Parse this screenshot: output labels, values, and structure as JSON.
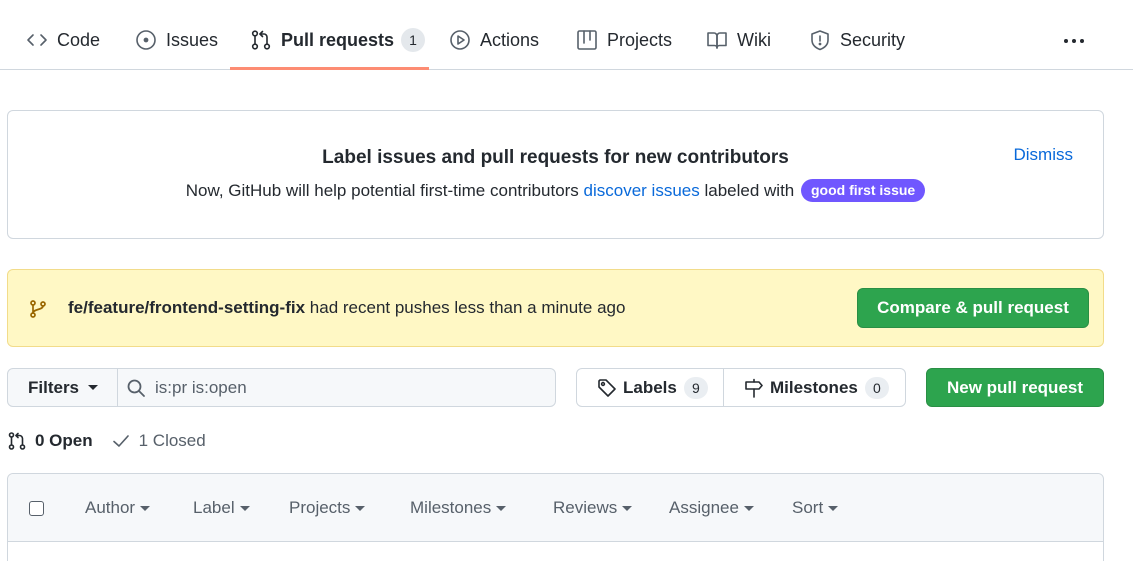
{
  "nav": {
    "tabs": [
      {
        "label": "Code",
        "icon": "code-icon"
      },
      {
        "label": "Issues",
        "icon": "issue-opened-icon"
      },
      {
        "label": "Pull requests",
        "icon": "git-pull-request-icon",
        "count": "1",
        "selected": true
      },
      {
        "label": "Actions",
        "icon": "play-icon"
      },
      {
        "label": "Projects",
        "icon": "table-icon"
      },
      {
        "label": "Wiki",
        "icon": "book-icon"
      },
      {
        "label": "Security",
        "icon": "shield-icon"
      }
    ],
    "more_icon": "kebab-horizontal-icon"
  },
  "contributors_banner": {
    "title": "Label issues and pull requests for new contributors",
    "text_before": "Now, GitHub will help potential first-time contributors ",
    "link": "discover issues",
    "text_after": " labeled with ",
    "label": "good first issue",
    "label_color": "#7057ff",
    "dismiss": "Dismiss"
  },
  "recent_push": {
    "branch": "fe/feature/frontend-setting-fix",
    "message": " had recent pushes less than a minute ago",
    "button": "Compare & pull request",
    "background": "#fff8c5"
  },
  "toolbar": {
    "filters_label": "Filters",
    "search_value": "is:pr is:open",
    "labels_label": "Labels",
    "labels_count": "9",
    "milestones_label": "Milestones",
    "milestones_count": "0",
    "new_pr_label": "New pull request",
    "accent": "#2da44e"
  },
  "states": {
    "open": "0 Open",
    "closed": "1 Closed"
  },
  "list_header": {
    "filters": [
      "Author",
      "Label",
      "Projects",
      "Milestones",
      "Reviews",
      "Assignee",
      "Sort"
    ]
  }
}
